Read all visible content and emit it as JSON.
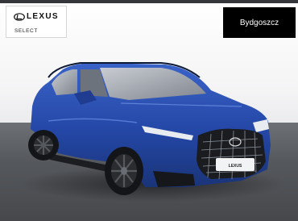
{
  "dealer": {
    "brand_logo_text": "LEXUS",
    "program_label": "SELECT"
  },
  "location": {
    "label": "Bydgoszcz"
  },
  "vehicle_photo": {
    "description_icon": "car-photo",
    "body_color": "#2a4fb0",
    "plate_logo_text": "LEXUS"
  },
  "colors": {
    "location_bg": "#000000",
    "location_text": "#ffffff",
    "floor": "#55585c"
  }
}
